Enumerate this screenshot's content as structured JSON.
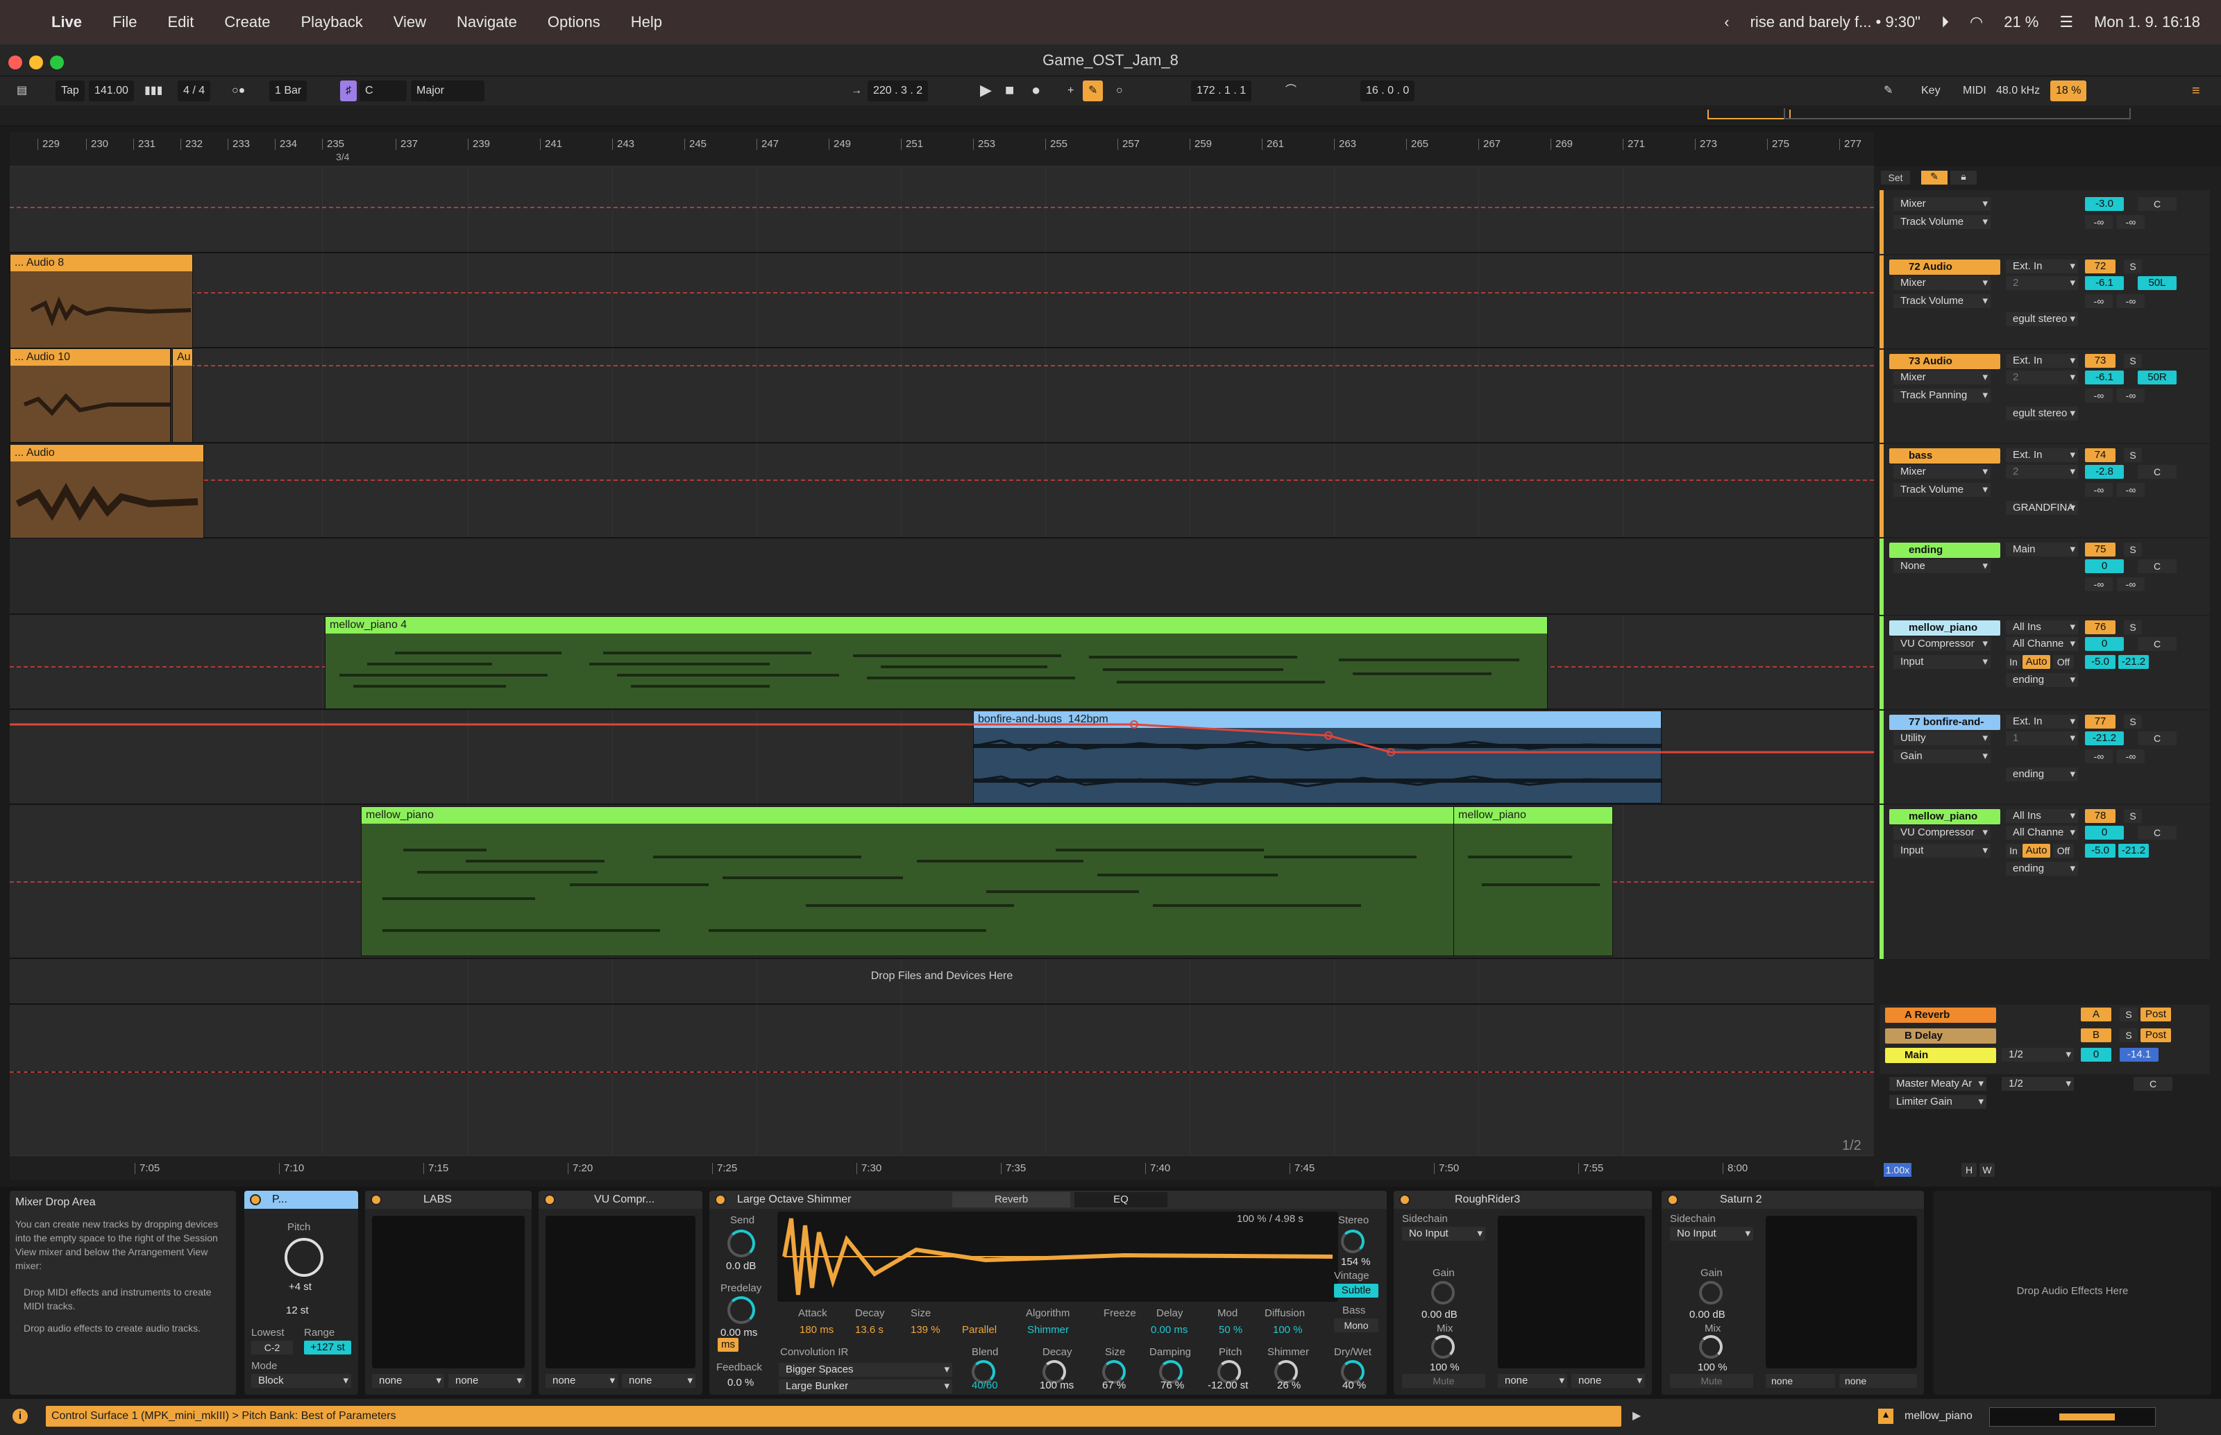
{
  "menubar": {
    "app": "Live",
    "items": [
      "File",
      "Edit",
      "Create",
      "Playback",
      "View",
      "Navigate",
      "Options",
      "Help"
    ],
    "now_playing": "rise and barely f... • 9:30\"",
    "battery": "21 %",
    "datetime": "Mon 1. 9.  16:18"
  },
  "window": {
    "title": "Game_OST_Jam_8"
  },
  "transport": {
    "tap": "Tap",
    "tempo": "141.00",
    "signature": "4 / 4",
    "quantize": "1 Bar",
    "key_root": "C",
    "key_scale": "Major",
    "arrangement_position": "220 .  3 .  2",
    "loop_start": "172 .  1 .  1",
    "loop_length": "16 .  0 .  0",
    "key_label": "Key",
    "midi_label": "MIDI",
    "sample_rate": "48.0 kHz",
    "cpu": "18 %"
  },
  "ruler": {
    "bars": [
      "229",
      "230",
      "231",
      "232",
      "233",
      "234",
      "235",
      "237",
      "239",
      "241",
      "243",
      "245",
      "247",
      "249",
      "251",
      "253",
      "255",
      "257",
      "259",
      "261",
      "263",
      "265",
      "267",
      "269",
      "271",
      "273",
      "275",
      "277"
    ],
    "time_sig_marker": "3/4"
  },
  "timeruler": {
    "times": [
      "7:05",
      "7:10",
      "7:15",
      "7:20",
      "7:25",
      "7:30",
      "7:35",
      "7:40",
      "7:45",
      "7:50",
      "7:55",
      "8:00"
    ],
    "page": "1/2",
    "zoom": "1.00x"
  },
  "clips": {
    "audio8": "... Audio 8",
    "audio10": "... Audio 10",
    "audio10b": "Au",
    "audio": "... Audio",
    "mellow4": "mellow_piano 4",
    "bonfire": "bonfire-and-bugs_142bpm",
    "mellow": "mellow_piano",
    "mellow2": "mellow_piano",
    "drop": "Drop Files and Devices Here"
  },
  "mixer_top": {
    "set": "Set"
  },
  "tracks": [
    {
      "name": "",
      "dd1": "Mixer",
      "dd2": "Track Volume",
      "in": "",
      "ch": "",
      "vol": "-3.0",
      "pan": "C",
      "inf": "-∞",
      "inf2": "-∞"
    },
    {
      "name": "72 Audio",
      "dd1": "Mixer",
      "dd2": "Track Volume",
      "in": "Ext. In",
      "ch": "2",
      "num": "72",
      "vol": "-6.1",
      "pan": "50L",
      "out": "egult stereo",
      "inf": "-∞",
      "inf2": "-∞"
    },
    {
      "name": "73 Audio",
      "dd1": "Mixer",
      "dd2": "Track Panning",
      "in": "Ext. In",
      "ch": "2",
      "num": "73",
      "vol": "-6.1",
      "pan": "50R",
      "out": "egult stereo",
      "inf": "-∞",
      "inf2": "-∞"
    },
    {
      "name": "bass",
      "dd1": "Mixer",
      "dd2": "Track Volume",
      "in": "Ext. In",
      "ch": "2",
      "num": "74",
      "vol": "-2.8",
      "pan": "C",
      "out": "GRANDFINA",
      "inf": "-∞",
      "inf2": "-∞"
    },
    {
      "name": "ending",
      "dd1": "None",
      "dd2": "",
      "in": "Main",
      "ch": "",
      "num": "75",
      "vol": "0",
      "pan": "C",
      "out": "",
      "inf": "-∞",
      "inf2": "-∞"
    },
    {
      "name": "mellow_piano",
      "dd1": "VU Compressor",
      "dd2": "Input",
      "in": "All Ins",
      "ch": "All Channe",
      "num": "76",
      "vol": "0",
      "pan": "C",
      "out": "ending",
      "inf": "-5.0",
      "inf2": "-21.2"
    },
    {
      "name": "77 bonfire-and-",
      "dd1": "Utility",
      "dd2": "Gain",
      "in": "Ext. In",
      "ch": "1",
      "num": "77",
      "vol": "-21.2",
      "pan": "C",
      "out": "ending",
      "inf": "-∞",
      "inf2": "-∞"
    },
    {
      "name": "mellow_piano",
      "dd1": "VU Compressor",
      "dd2": "Input",
      "in": "All Ins",
      "ch": "All Channe",
      "num": "78",
      "vol": "0",
      "pan": "C",
      "out": "ending",
      "inf": "-5.0",
      "inf2": "-21.2"
    }
  ],
  "returns": {
    "a": "A Reverb",
    "b": "B Delay",
    "a_letter": "A",
    "b_letter": "B",
    "post": "Post",
    "main": "Main",
    "main_out": "1/2",
    "main_dd1": "Master Meaty Ar",
    "main_dd2": "Limiter Gain",
    "main_vol": "0",
    "main_pan": "-14.1",
    "main_c": "C",
    "solo": "S",
    "in_label": "In",
    "auto_label": "Auto",
    "off_label": "Off",
    "h": "H",
    "w": "W"
  },
  "devices": {
    "info_title": "Mixer Drop Area",
    "info_text": "You can create new tracks by dropping devices into the empty space to the right of the Session View mixer and below the Arrangement View mixer:",
    "info_b1": "Drop MIDI effects and instruments to create MIDI tracks.",
    "info_b2": "Drop audio effects to create audio tracks.",
    "pitch_name": "P...",
    "pitch_label": "Pitch",
    "pitch_val": "+4 st",
    "pitch_range": "12 st",
    "lowest": "Lowest",
    "lowest_val": "C-2",
    "range": "Range",
    "range_val": "+127 st",
    "mode": "Mode",
    "mode_val": "Block",
    "labs": "LABS",
    "vu": "VU Compr...",
    "none": "none",
    "shimmer": "Large Octave Shimmer",
    "tab_reverb": "Reverb",
    "tab_eq": "EQ",
    "wave_info": "100 % / 4.98 s",
    "send": "Send",
    "send_val": "0.0 dB",
    "predelay": "Predelay",
    "predelay_val": "0.00 ms",
    "feedback": "Feedback",
    "feedback_val": "0.0 %",
    "ms": "ms",
    "attack": "Attack",
    "attack_val": "180 ms",
    "decay": "Decay",
    "decay_val": "13.6 s",
    "size": "Size",
    "size_val": "139 %",
    "parallel": "Parallel",
    "algorithm": "Algorithm",
    "algorithm_val": "Shimmer",
    "freeze": "Freeze",
    "delay": "Delay",
    "delay_val": "0.00 ms",
    "mod": "Mod",
    "mod_val": "50 %",
    "diffusion": "Diffusion",
    "diffusion_val": "100 %",
    "conv_ir": "Convolution IR",
    "ir1": "Bigger Spaces",
    "ir2": "Large Bunker",
    "blend": "Blend",
    "blend_val": "40/60",
    "decay2": "Decay",
    "decay2_val": "100 ms",
    "size2": "Size",
    "size2_val": "67 %",
    "damping": "Damping",
    "damping_val": "76 %",
    "pitch2": "Pitch",
    "pitch2_val": "-12.00 st",
    "shimmer2": "Shimmer",
    "shimmer2_val": "26 %",
    "stereo": "Stereo",
    "stereo_val": "154 %",
    "vintage": "Vintage",
    "vintage_val": "Subtle",
    "bass": "Bass",
    "bass_val": "Mono",
    "drywet": "Dry/Wet",
    "drywet_val": "40 %",
    "rr": "RoughRider3",
    "sidechain": "Sidechain",
    "noinput": "No Input",
    "gain": "Gain",
    "gain_val": "0.00 dB",
    "mix": "Mix",
    "mix_val": "100 %",
    "mute": "Mute",
    "sat": "Saturn 2",
    "drop_fx": "Drop Audio Effects Here"
  },
  "status": {
    "message": "Control Surface 1 (MPK_mini_mkIII) > Pitch Bank: Best of Parameters",
    "track": "mellow_piano"
  },
  "colors": {
    "orange": "#f0a63c",
    "green": "#8cf05a",
    "blue": "#8ec6f5",
    "yellow": "#f2f04a",
    "accent_cyan": "#1ec9d0"
  }
}
